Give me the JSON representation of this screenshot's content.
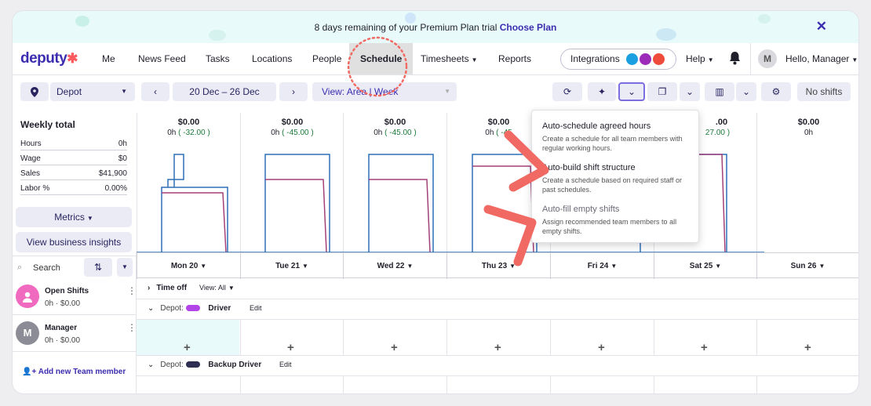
{
  "banner": {
    "text": "8 days remaining of your Premium Plan trial ",
    "link": "Choose Plan",
    "close": "✕"
  },
  "nav": {
    "logo": "deputy",
    "items": [
      "Me",
      "News Feed",
      "Tasks",
      "Locations",
      "People",
      "Schedule",
      "Timesheets",
      "Reports"
    ],
    "integrations": "Integrations",
    "help": "Help",
    "greeting": "Hello, Manager",
    "avatar_initial": "M"
  },
  "toolbar": {
    "location": "Depot",
    "date_range": "20 Dec – 26 Dec",
    "view": "View: Area | Week",
    "no_shifts": "No shifts"
  },
  "weekly": {
    "title": "Weekly total",
    "stats": [
      {
        "label": "Hours",
        "value": "0h"
      },
      {
        "label": "Wage",
        "value": "$0"
      },
      {
        "label": "Sales",
        "value": "$41,900"
      },
      {
        "label": "Labor %",
        "value": "0.00%"
      }
    ],
    "metrics_button": "Metrics",
    "insights_button": "View business insights"
  },
  "days": [
    {
      "amount": "$0.00",
      "hours": "0h",
      "delta": "( -32.00 )",
      "label": "Mon 20"
    },
    {
      "amount": "$0.00",
      "hours": "0h",
      "delta": "( -45.00 )",
      "label": "Tue 21"
    },
    {
      "amount": "$0.00",
      "hours": "0h",
      "delta": "( -45.00 )",
      "label": "Wed 22"
    },
    {
      "amount": "$0.00",
      "hours": "0h",
      "delta": "( -45",
      "label": "Thu 23"
    },
    {
      "amount": "",
      "hours": "",
      "delta": "",
      "label": "Fri 24"
    },
    {
      "amount": ".00",
      "hours": "",
      "delta": "27.00 )",
      "label": "Sat 25"
    },
    {
      "amount": "$0.00",
      "hours": "0h",
      "delta": "",
      "label": "Sun 26"
    }
  ],
  "search": {
    "label": "Search"
  },
  "sections": {
    "time_off": "Time off",
    "view_all": "View: All",
    "depot_label": "Depot:",
    "driver": "Driver",
    "backup_driver": "Backup Driver",
    "edit": "Edit"
  },
  "members": [
    {
      "name": "Open Shifts",
      "meta": "0h · $0.00",
      "initial": ""
    },
    {
      "name": "Manager",
      "meta": "0h · $0.00",
      "initial": "M"
    }
  ],
  "add_member": "Add new Team member",
  "dropdown": [
    {
      "title": "Auto-schedule agreed hours",
      "desc": "Create a schedule for all team members with regular working hours."
    },
    {
      "title": "Auto-build shift structure",
      "desc": "Create a schedule based on required staff or past schedules."
    },
    {
      "title": "Auto-fill empty shifts",
      "desc": "Assign recommended team members to all empty shifts."
    }
  ],
  "colors": {
    "brand": "#3c2db0",
    "accent": "#ff5a5f",
    "driver": "#b344e8",
    "backup": "#2e2d52",
    "annotation": "#f06a63"
  }
}
